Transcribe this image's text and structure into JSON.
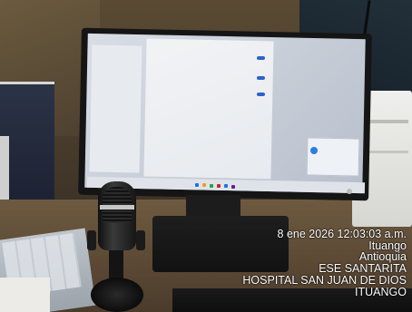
{
  "overlay": {
    "datetime": "8 ene 2026 12:03:03 a.m.",
    "place": "Ituango",
    "region": "Antioquia",
    "org": "ESE SANTARITA",
    "hospital": "HOSPITAL SAN JUAN DE DIOS",
    "town": "ITUANGO"
  },
  "colors": {
    "overlay_text": "#ffffff",
    "screen_accent": "#2a64c9"
  }
}
